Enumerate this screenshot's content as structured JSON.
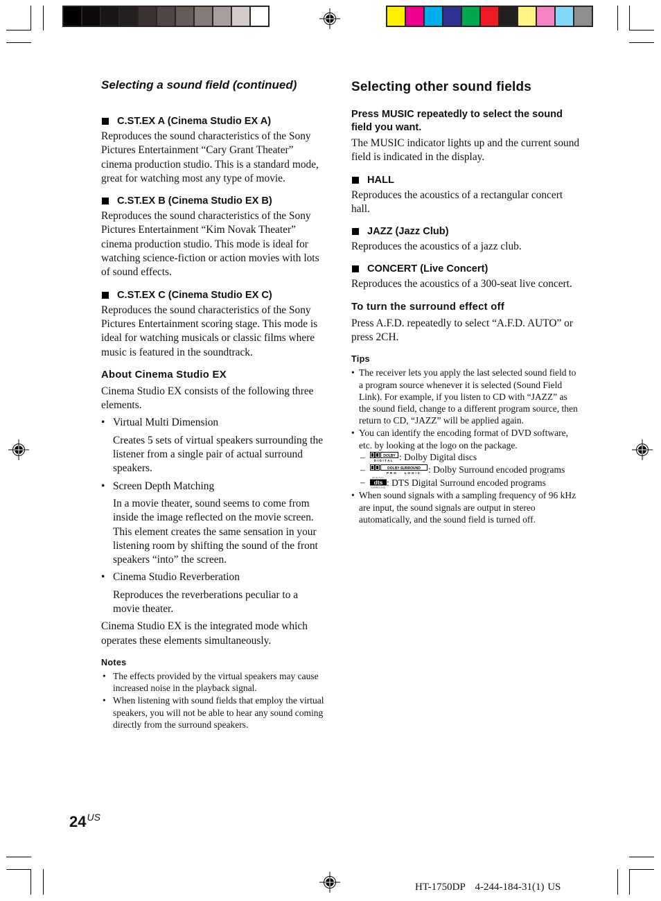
{
  "print_marks": {
    "grayscale_swatches": [
      "#000000",
      "#0d0a09",
      "#191514",
      "#231f1e",
      "#3a3230",
      "#4f4745",
      "#655b59",
      "#857b79",
      "#a79f9d",
      "#d3cbc9",
      "#ffffff"
    ],
    "color_swatches": [
      "#fff200",
      "#ec008c",
      "#00aeef",
      "#2e3192",
      "#00a650",
      "#ed1c24",
      "#231f20",
      "#fff685",
      "#f683c6",
      "#82d8f7",
      "#8e8e8e"
    ]
  },
  "left_column": {
    "running_head": "Selecting a sound field (continued)",
    "modes": [
      {
        "heading": "C.ST.EX A (Cinema Studio EX A)",
        "body": "Reproduces the sound characteristics of the Sony Pictures Entertainment “Cary Grant Theater” cinema production studio. This is a standard mode, great for watching most any type of movie."
      },
      {
        "heading": "C.ST.EX B (Cinema Studio EX B)",
        "body": "Reproduces the sound characteristics of the Sony Pictures Entertainment “Kim Novak Theater” cinema production studio. This mode is ideal for watching science-fiction or action movies with lots of sound effects."
      },
      {
        "heading": "C.ST.EX C (Cinema Studio EX C)",
        "body": "Reproduces the sound characteristics of the Sony Pictures Entertainment scoring stage. This mode is ideal for watching musicals or classic films where music is featured in the soundtrack."
      }
    ],
    "about": {
      "heading": "About Cinema Studio EX",
      "intro": "Cinema Studio EX consists of the following three elements.",
      "elements": [
        {
          "title": "Virtual Multi Dimension",
          "body": "Creates 5 sets of virtual speakers surrounding the listener from a single pair of actual surround speakers."
        },
        {
          "title": "Screen Depth Matching",
          "body": "In a movie theater, sound seems to come from inside the image reflected on the movie screen. This element creates the same sensation in your listening room by shifting the sound of the front speakers “into” the screen."
        },
        {
          "title": "Cinema Studio Reverberation",
          "body": "Reproduces the reverberations peculiar to a movie theater."
        }
      ],
      "outro": "Cinema Studio EX is the integrated mode which operates these elements simultaneously."
    },
    "notes": {
      "heading": "Notes",
      "items": [
        "The effects provided by the virtual speakers may cause increased noise in the playback signal.",
        "When listening with sound fields that employ the virtual speakers, you will not be able to hear any sound coming directly from the surround speakers."
      ]
    }
  },
  "right_column": {
    "title": "Selecting other sound fields",
    "instruction": "Press MUSIC repeatedly to select the sound field you want.",
    "instruction_body": "The MUSIC indicator lights up and the current sound field is indicated in the display.",
    "modes": [
      {
        "heading": "HALL",
        "body": "Reproduces the acoustics of a rectangular concert hall."
      },
      {
        "heading": "JAZZ (Jazz Club)",
        "body": "Reproduces the acoustics of a jazz club."
      },
      {
        "heading": "CONCERT (Live Concert)",
        "body": "Reproduces the acoustics of a 300-seat live concert."
      }
    ],
    "surround_off": {
      "heading": "To turn the surround effect off",
      "body": "Press A.F.D. repeatedly to select “A.F.D. AUTO” or press 2CH."
    },
    "tips": {
      "heading": "Tips",
      "item1": "The receiver lets you apply the last selected sound field to a program source whenever it is selected (Sound Field Link). For example, if you listen to CD with “JAZZ” as the sound field, change to a different program source, then return to CD, “JAZZ” will be applied again.",
      "item2": "You can identify the encoding format of DVD software, etc. by looking at the logo on the  package.",
      "logos": [
        {
          "icon": "dolby-digital-logo",
          "logo_text": "DOLBY",
          "logo_sub": "DIGITAL",
          "label": ": Dolby Digital discs"
        },
        {
          "icon": "dolby-surround-pro-logic-logo",
          "logo_text": "DOLBY SURROUND",
          "logo_sub": "PRO · LOGIC",
          "label": ": Dolby Surround encoded programs"
        },
        {
          "icon": "dts-digital-surround-logo",
          "logo_text": "dts",
          "logo_top": "DIGITAL",
          "logo_sub": "SURROUND",
          "label": ": DTS Digital Surround encoded programs"
        }
      ],
      "item3": "When sound signals with a sampling frequency of 96 kHz are input, the sound signals are output in stereo automatically, and the sound field is turned off."
    }
  },
  "footer": {
    "page_number": "24",
    "page_suffix": "US",
    "model_code": "HT-1750DP   4-244-184-31(1) US"
  }
}
